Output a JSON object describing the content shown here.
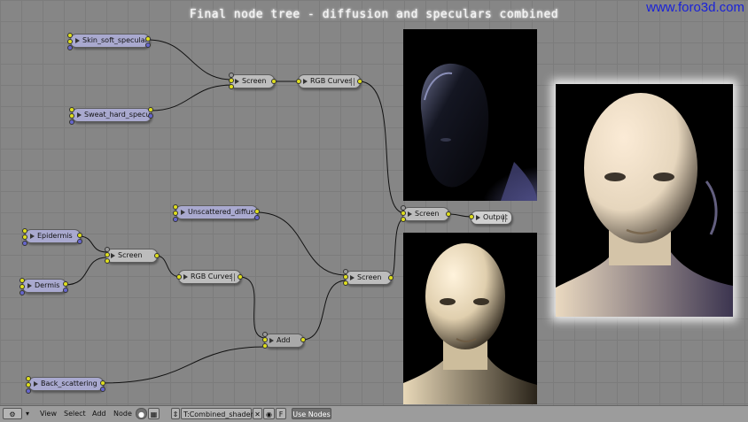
{
  "title": "Final node tree - diffusion and speculars combined",
  "watermark": "www.foro3d.com",
  "nodes": {
    "skin_soft_specular": "Skin_soft_specular",
    "sweat_hard_specular": "Sweat_hard_specu",
    "screen_top": "Screen",
    "rgb_curves_top": "RGB Curves",
    "screen_right": "Screen",
    "output": "Output",
    "unscattered_diffuse": "Unscattered_diffus",
    "epidermis": "Epidermis",
    "dermis": "Dermis",
    "screen_left": "Screen",
    "rgb_curves_bottom": "RGB Curves",
    "screen_mid": "Screen",
    "add": "Add",
    "back_scattering": "Back_scattering"
  },
  "header": {
    "menu_view": "View",
    "menu_select": "Select",
    "menu_add": "Add",
    "menu_node": "Node",
    "node_tree_name": "T:Combined_shaders",
    "fake_user": "F",
    "use_nodes": "Use Nodes"
  },
  "colors": {
    "socket_color": "#dede1e",
    "socket_vector": "#6666cc",
    "background": "#868686",
    "watermark": "#1a22d8"
  }
}
